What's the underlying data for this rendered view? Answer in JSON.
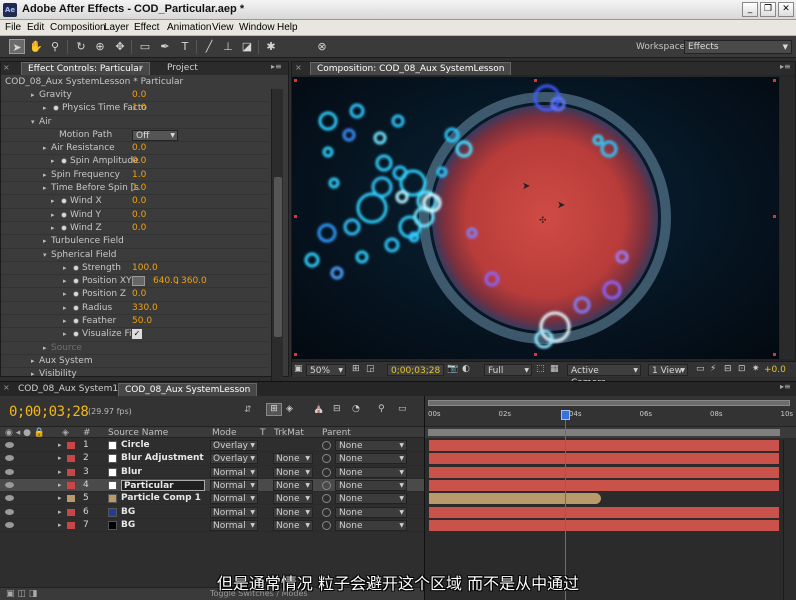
{
  "window": {
    "title": "Adobe After Effects - COD_Particular.aep *",
    "app_icon": "Ae"
  },
  "menu": [
    "File",
    "Edit",
    "Composition",
    "Layer",
    "Effect",
    "Animation",
    "View",
    "Window",
    "Help"
  ],
  "workspace": {
    "label": "Workspace:",
    "value": "Effects"
  },
  "left_panel": {
    "tab_effect_controls": "Effect Controls: Particular",
    "tab_project": "Project",
    "header": "COD_08_Aux SystemLesson * Particular",
    "rows": [
      {
        "label": "Gravity",
        "value": "0.0",
        "indent": 0,
        "stopwatch": false
      },
      {
        "label": "Physics Time Facto",
        "value": "1.0",
        "indent": 1,
        "stopwatch": true
      },
      {
        "label": "Air",
        "value": "",
        "indent": 0,
        "stopwatch": false,
        "expanded": true
      },
      {
        "label": "Motion Path",
        "value": "Off",
        "indent": 2,
        "stopwatch": false,
        "dropdown": true
      },
      {
        "label": "Air Resistance",
        "value": "0.0",
        "indent": 1,
        "stopwatch": false
      },
      {
        "label": "Spin Amplitude",
        "value": "0.0",
        "indent": 2,
        "stopwatch": true
      },
      {
        "label": "Spin Frequency",
        "value": "1.0",
        "indent": 1,
        "stopwatch": false
      },
      {
        "label": "Time Before Spin [s",
        "value": "1.0",
        "indent": 1,
        "stopwatch": false
      },
      {
        "label": "Wind X",
        "value": "0.0",
        "indent": 2,
        "stopwatch": true
      },
      {
        "label": "Wind Y",
        "value": "0.0",
        "indent": 2,
        "stopwatch": true
      },
      {
        "label": "Wind Z",
        "value": "0.0",
        "indent": 2,
        "stopwatch": true
      },
      {
        "label": "Turbulence Field",
        "value": "",
        "indent": 1,
        "stopwatch": false
      },
      {
        "label": "Spherical Field",
        "value": "",
        "indent": 1,
        "stopwatch": false,
        "expanded": true
      },
      {
        "label": "Strength",
        "value": "100.0",
        "indent": 3,
        "stopwatch": true
      },
      {
        "label": "Position XY",
        "value": "640.0",
        "value2": "360.0",
        "indent": 3,
        "stopwatch": true
      },
      {
        "label": "Position Z",
        "value": "0.0",
        "indent": 3,
        "stopwatch": true
      },
      {
        "label": "Radius",
        "value": "330.0",
        "indent": 3,
        "stopwatch": true
      },
      {
        "label": "Feather",
        "value": "50.0",
        "indent": 3,
        "stopwatch": true
      },
      {
        "label": "Visualize Fiel",
        "value": "✓",
        "indent": 3,
        "stopwatch": true,
        "checkbox": true
      },
      {
        "label": "Source",
        "value": "",
        "indent": 1,
        "stopwatch": false,
        "dim": true
      },
      {
        "label": "Aux System",
        "value": "",
        "indent": 0,
        "stopwatch": false
      },
      {
        "label": "Visibility",
        "value": "",
        "indent": 0,
        "stopwatch": false
      }
    ]
  },
  "comp_panel": {
    "tab": "Composition: COD_08_Aux SystemLesson",
    "zoom": "50%",
    "timecode": "0;00;03;28",
    "resolution": "Full",
    "camera": "Active Camera",
    "views": "1 View",
    "exposure": "+0.0"
  },
  "timeline": {
    "tabs": [
      "COD_08_Aux System1",
      "COD_08_Aux SystemLesson"
    ],
    "timecode": "0;00;03;28",
    "fps": "(29.97 fps)",
    "col_headers": {
      "num": "#",
      "source": "Source Name",
      "mode": "Mode",
      "t": "T",
      "trkmat": "TrkMat",
      "parent": "Parent"
    },
    "ruler": [
      "00s",
      "02s",
      "04s",
      "06s",
      "08s",
      "10s"
    ],
    "playhead_fraction": 0.39,
    "layers": [
      {
        "num": "1",
        "name": "Circle",
        "mode": "Overlay",
        "trkmat": "",
        "parent": "None",
        "label_color": "#c84646",
        "swatch": "#ffffff",
        "bar_color": "#c9524b"
      },
      {
        "num": "2",
        "name": "Blur Adjustment",
        "mode": "Overlay",
        "trkmat": "None",
        "parent": "None",
        "label_color": "#c84646",
        "swatch": "#ffffff",
        "bar_color": "#c9524b"
      },
      {
        "num": "3",
        "name": "Blur",
        "mode": "Normal",
        "trkmat": "None",
        "parent": "None",
        "label_color": "#c84646",
        "swatch": "#ffffff",
        "bar_color": "#c9524b"
      },
      {
        "num": "4",
        "name": "Particular",
        "mode": "Normal",
        "trkmat": "None",
        "parent": "None",
        "label_color": "#c84646",
        "swatch": "#ffffff",
        "bar_color": "#c9524b",
        "selected": true
      },
      {
        "num": "5",
        "name": "Particle Comp 1",
        "mode": "Normal",
        "trkmat": "None",
        "parent": "None",
        "label_color": "#b99a6a",
        "swatch": "#b99a6a",
        "bar_color": "#b99a6a",
        "bar_end": 0.49
      },
      {
        "num": "6",
        "name": "BG",
        "mode": "Normal",
        "trkmat": "None",
        "parent": "None",
        "label_color": "#c84646",
        "swatch": "#1d3f9a",
        "bar_color": "#c9524b"
      },
      {
        "num": "7",
        "name": "BG",
        "mode": "Normal",
        "trkmat": "None",
        "parent": "None",
        "label_color": "#c84646",
        "swatch": "#000000",
        "bar_color": "#c9524b"
      }
    ],
    "footer": "Toggle Switches / Modes"
  },
  "subtitle": "但是通常情况 粒子会避开这个区域 而不是从中通过"
}
